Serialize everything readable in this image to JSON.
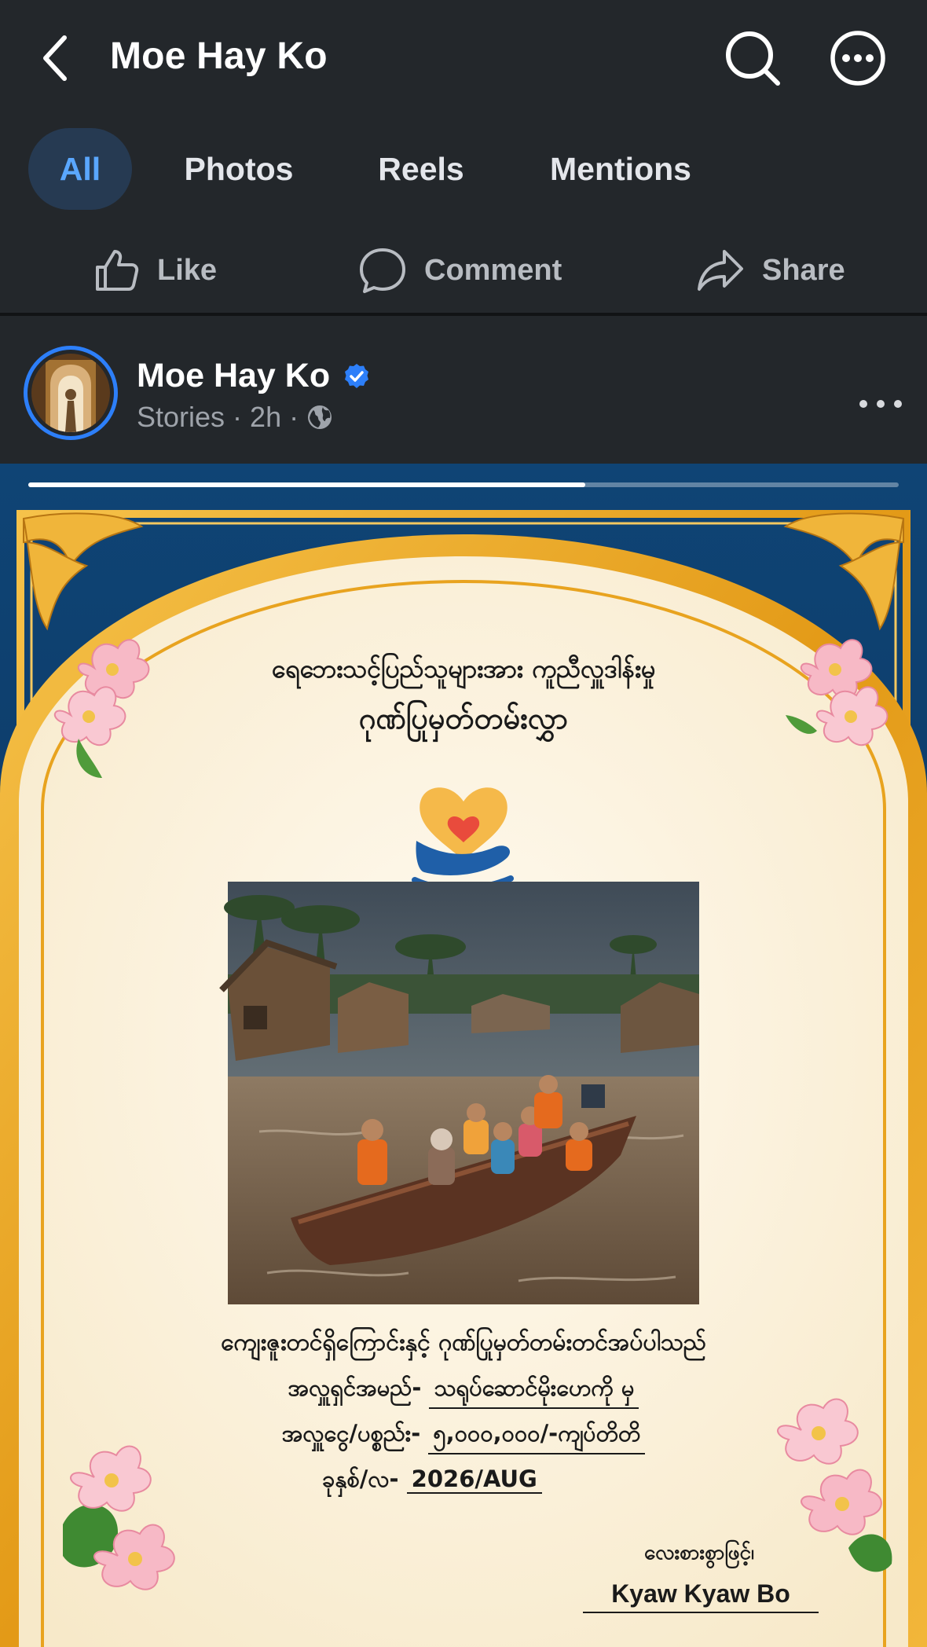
{
  "header": {
    "title": "Moe Hay Ko"
  },
  "tabs": [
    {
      "label": "All",
      "active": true
    },
    {
      "label": "Photos",
      "active": false
    },
    {
      "label": "Reels",
      "active": false
    },
    {
      "label": "Mentions",
      "active": false
    }
  ],
  "actions": {
    "like": "Like",
    "comment": "Comment",
    "share": "Share"
  },
  "post": {
    "author": "Moe Hay Ko",
    "verified": true,
    "source": "Stories",
    "time": "2h",
    "separator": "·",
    "audience_icon": "globe-icon"
  },
  "story": {
    "progress": 0.64,
    "title_line1": "ရေဘေးသင့်ပြည်သူများအား ကူညီလှူဒါန်းမှု",
    "title_line2": "ဂုဏ်ပြုမှတ်တမ်းလွှာ",
    "body_line1": "ကျေးဇူးတင်ရှိကြောင်းနှင့် ဂုဏ်ပြုမှတ်တမ်းတင်အပ်ပါသည်",
    "donor_label": "အလှူရှင်အမည်-",
    "donor_value": "သရုပ်ဆောင်မိုးဟေကို မှ",
    "amount_label": "အလှူငွေ/ပစ္စည်း-",
    "amount_value": "၅,၀၀၀,၀၀၀/-ကျပ်တိတိ",
    "date_label": "ခုနှစ်/လ-",
    "date_value": "2026/AUG",
    "signed_label": "လေးစားစွာဖြင့်၊",
    "signed_name": "Kyaw Kyaw Bo"
  },
  "colors": {
    "background": "#23272b",
    "accent": "#2d7ff9",
    "active_tab_bg": "#263a52",
    "active_tab_text": "#5aa7ff",
    "poster_blue": "#0d3a64",
    "poster_gold": "#e8a31f",
    "poster_cream": "#fcf3df"
  }
}
